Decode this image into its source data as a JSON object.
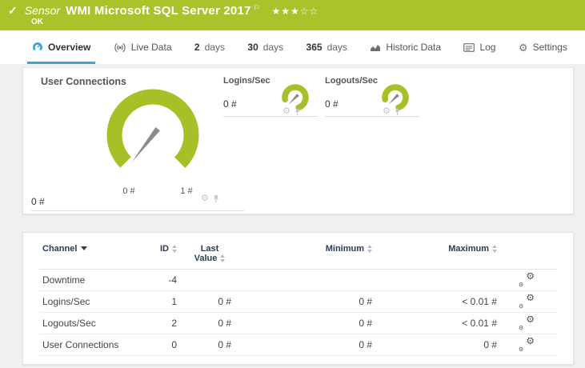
{
  "header": {
    "check_icon": "✓",
    "sensor_label": "Sensor",
    "title": "WMI Microsoft SQL Server 2017",
    "flag_icon": "⚐",
    "rating": "★★★☆☆",
    "status": "OK"
  },
  "tabs": [
    {
      "label": "Overview",
      "active": true
    },
    {
      "label": "Live Data"
    },
    {
      "num": "2",
      "unit": "days"
    },
    {
      "num": "30",
      "unit": "days"
    },
    {
      "num": "365",
      "unit": "days"
    },
    {
      "label": "Historic Data"
    },
    {
      "label": "Log"
    },
    {
      "label": "Settings"
    }
  ],
  "gauges": {
    "main": {
      "title": "User Connections",
      "value": "0 #",
      "scale_min": "0 #",
      "scale_max": "1 #"
    },
    "small": [
      {
        "title": "Logins/Sec",
        "value": "0 #"
      },
      {
        "title": "Logouts/Sec",
        "value": "0 #"
      }
    ]
  },
  "icons": {
    "gear": "⚙"
  },
  "table": {
    "headers": {
      "channel": "Channel",
      "id": "ID",
      "last": "Last Value",
      "min": "Minimum",
      "max": "Maximum"
    },
    "rows": [
      {
        "channel": "Downtime",
        "id": "-4",
        "last": "",
        "min": "",
        "max": ""
      },
      {
        "channel": "Logins/Sec",
        "id": "1",
        "last": "0 #",
        "min": "0 #",
        "max": "< 0.01 #"
      },
      {
        "channel": "Logouts/Sec",
        "id": "2",
        "last": "0 #",
        "min": "0 #",
        "max": "< 0.01 #"
      },
      {
        "channel": "User Connections",
        "id": "0",
        "last": "0 #",
        "min": "0 #",
        "max": "0 #"
      }
    ]
  },
  "colors": {
    "brand_green": "#a9c32b",
    "gauge_green": "#a6c127",
    "accent_blue": "#35a7db",
    "header_navy": "#2b3a55"
  }
}
